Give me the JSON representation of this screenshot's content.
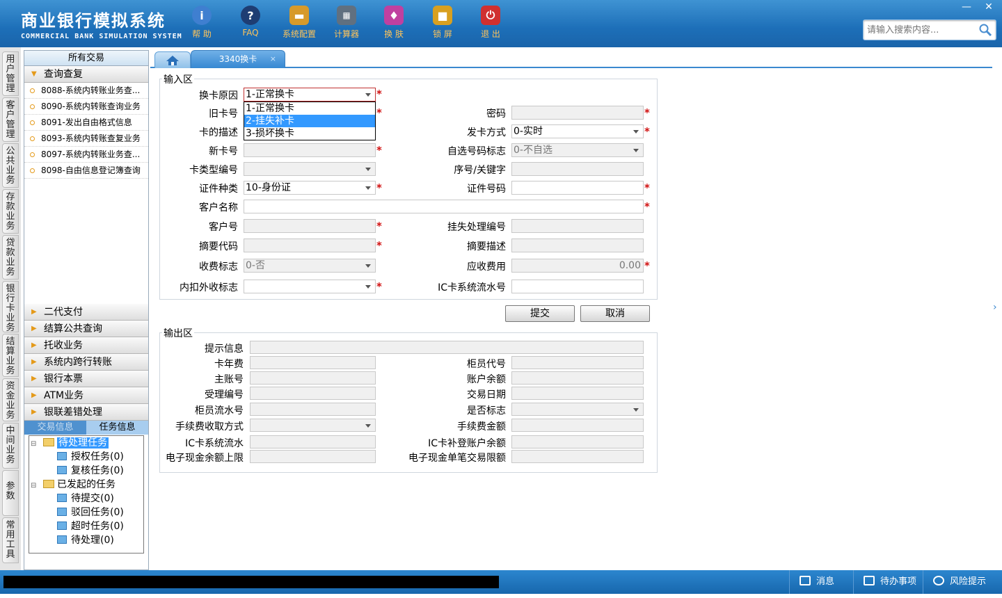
{
  "app": {
    "title_zh": "商业银行模拟系统",
    "title_en": "COMMERCIAL BANK SIMULATION SYSTEM",
    "window_minimize": "—",
    "window_close": "✕"
  },
  "toolbar": [
    {
      "label": "帮 助",
      "icon": "info-icon",
      "color": "#3f7fd0"
    },
    {
      "label": "FAQ",
      "icon": "question-icon",
      "color": "#1e3d73"
    },
    {
      "label": "系统配置",
      "icon": "toolbox-icon",
      "color": "#d79a2a"
    },
    {
      "label": "计算器",
      "icon": "calculator-icon",
      "color": "#607080"
    },
    {
      "label": "换 肤",
      "icon": "shirt-icon",
      "color": "#c040a0"
    },
    {
      "label": "锁 屏",
      "icon": "lock-icon",
      "color": "#d8a020"
    },
    {
      "label": "退 出",
      "icon": "power-icon",
      "color": "#d03030"
    }
  ],
  "search": {
    "placeholder": "请输入搜索内容..."
  },
  "vtabs": [
    "用户管理",
    "客户管理",
    "公共业务",
    "存款业务",
    "贷款业务",
    "银行卡业务",
    "结算业务",
    "资金业务",
    "中间业务",
    "参数",
    "常用工具"
  ],
  "left": {
    "header": "所有交易",
    "section_open": "查询查复",
    "items": [
      "8088-系统内转账业务查...",
      "8090-系统内转账查询业务",
      "8091-发出自由格式信息",
      "8093-系统内转账查复业务",
      "8097-系统内转账业务查...",
      "8098-自由信息登记簿查询"
    ],
    "sections": [
      "二代支付",
      "结算公共查询",
      "托收业务",
      "系统内跨行转账",
      "银行本票",
      "ATM业务",
      "银联差错处理"
    ],
    "tabs": [
      "交易信息",
      "任务信息"
    ],
    "tree": {
      "pending": "待处理任务",
      "auth": "授权任务(0)",
      "review": "复核任务(0)",
      "initiated": "已发起的任务",
      "to_submit": "待提交(0)",
      "rejected": "驳回任务(0)",
      "timeout": "超时任务(0)",
      "to_process": "待处理(0)"
    }
  },
  "tabs": {
    "active": "3340换卡",
    "close": "×"
  },
  "input": {
    "legend": "输入区",
    "reason_label": "换卡原因",
    "reason_value": "1-正常换卡",
    "reason_options": [
      "1-正常换卡",
      "2-挂失补卡",
      "3-损坏换卡"
    ],
    "old_card_label": "旧卡号",
    "password_label": "密码",
    "card_desc_label": "卡的描述",
    "issue_mode_label": "发卡方式",
    "issue_mode_value": "0-实时",
    "new_card_label": "新卡号",
    "self_select_label": "自选号码标志",
    "self_select_value": "0-不自选",
    "card_type_label": "卡类型编号",
    "seq_label": "序号/关键字",
    "id_type_label": "证件种类",
    "id_type_value": "10-身份证",
    "id_no_label": "证件号码",
    "cust_name_label": "客户名称",
    "cust_no_label": "客户号",
    "loss_no_label": "挂失处理编号",
    "summary_code_label": "摘要代码",
    "summary_desc_label": "摘要描述",
    "fee_flag_label": "收费标志",
    "fee_flag_value": "0-否",
    "fee_due_label": "应收费用",
    "fee_due_value": "0.00",
    "inner_outer_label": "内扣外收标志",
    "ic_flow_label": "IC卡系统流水号",
    "submit": "提交",
    "cancel": "取消"
  },
  "output": {
    "legend": "输出区",
    "hint_label": "提示信息",
    "card_fee_label": "卡年费",
    "teller_code_label": "柜员代号",
    "main_acct_label": "主账号",
    "balance_label": "账户余额",
    "accept_no_label": "受理编号",
    "tx_date_label": "交易日期",
    "teller_flow_label": "柜员流水号",
    "yes_no_label": "是否标志",
    "fee_method_label": "手续费收取方式",
    "fee_amount_label": "手续费金额",
    "ic_flow_label": "IC卡系统流水",
    "ic_balance_label": "IC卡补登账户余额",
    "ecash_limit_label": "电子现金余额上限",
    "ecash_single_label": "电子现金单笔交易限额"
  },
  "status": {
    "messages": "消息",
    "todo": "待办事项",
    "risk": "风险提示"
  }
}
